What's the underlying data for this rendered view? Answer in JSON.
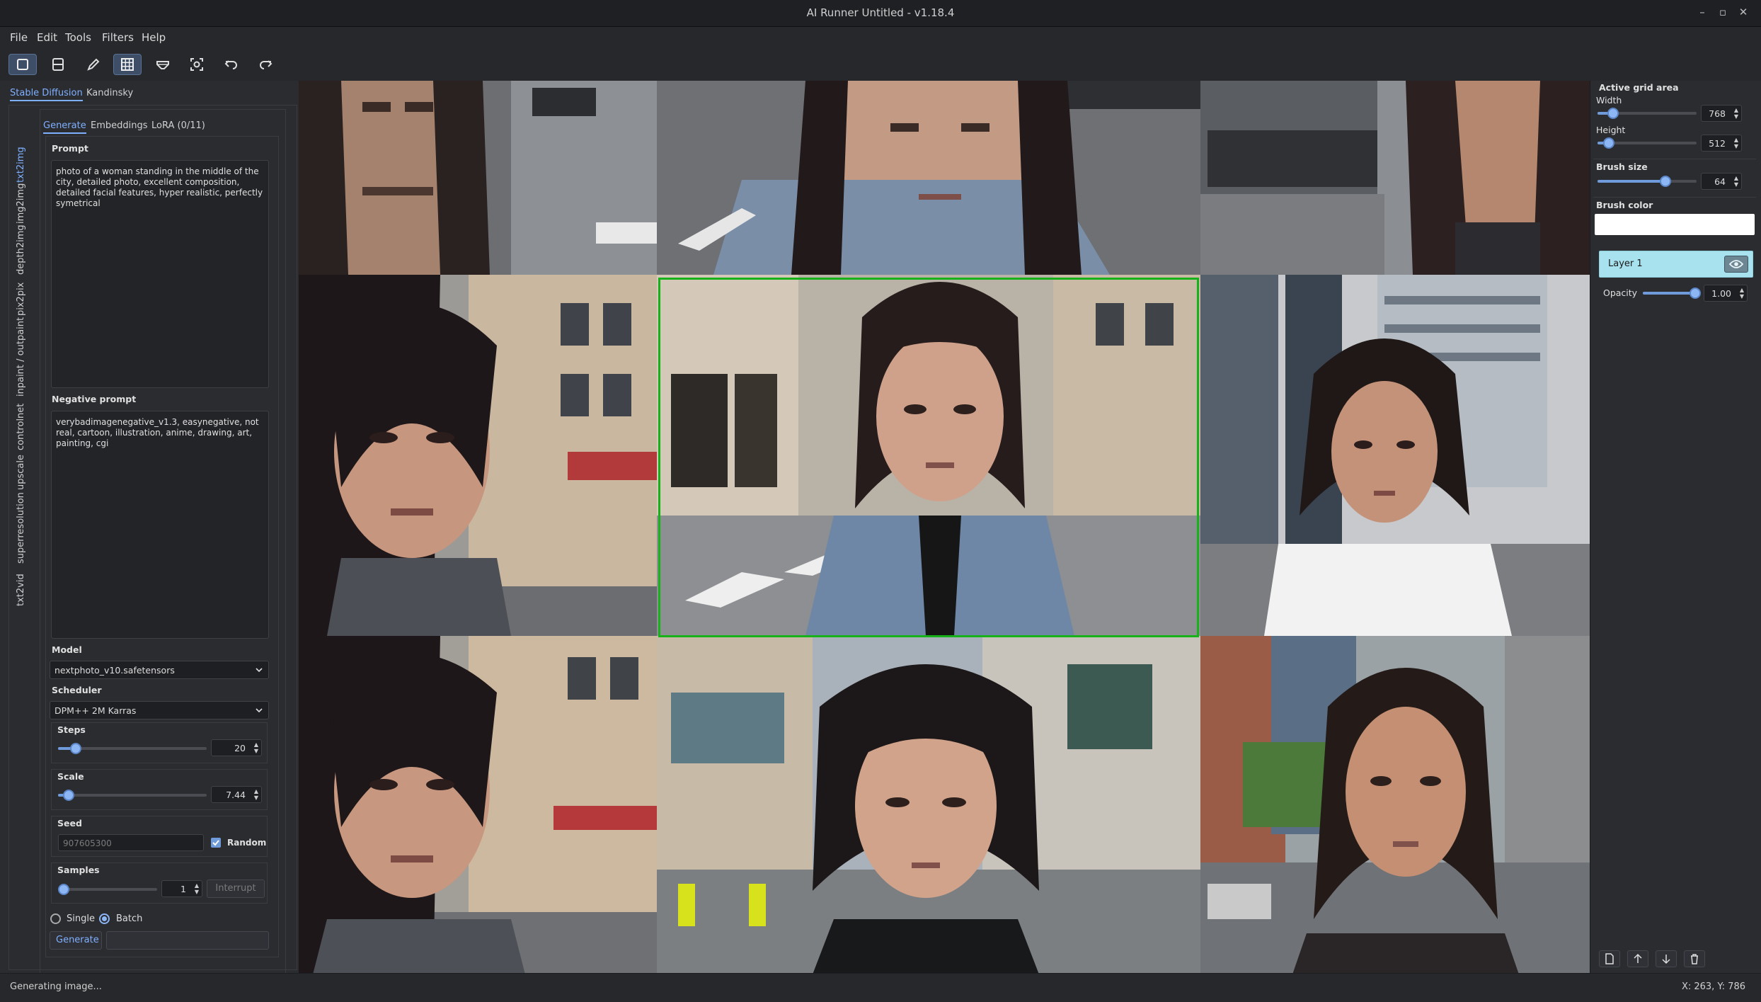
{
  "window": {
    "title": "AI Runner Untitled - v1.18.4",
    "minimize_glyph": "–",
    "maximize_glyph": "▫",
    "close_glyph": "✕"
  },
  "menu": [
    "File",
    "Edit",
    "Tools",
    "Filters",
    "Help"
  ],
  "toolbar": {
    "tools": [
      "active-grid-select-icon",
      "active-grid-half-icon",
      "brush-pencil-icon",
      "grid-icon",
      "eraser-icon",
      "focus-screenshot-icon",
      "undo-icon",
      "redo-icon"
    ]
  },
  "model_tabs": [
    "Stable Diffusion",
    "Kandinsky"
  ],
  "side_tabs": [
    "txt2img",
    "img2img",
    "depth2img",
    "pix2pix",
    "inpaint / outpaint",
    "controlnet",
    "upscale",
    "superresolution",
    "txt2vid"
  ],
  "sub_tabs": [
    "Generate",
    "Embeddings",
    "LoRA (0/11)"
  ],
  "prompt": {
    "label": "Prompt",
    "value": "photo of a woman standing in the middle of the city, detailed photo, excellent composition, detailed facial features, hyper realistic, perfectly symetrical"
  },
  "negative_prompt": {
    "label": "Negative prompt",
    "value": "verybadimagenegative_v1.3, easynegative, not real, cartoon, illustration, anime, drawing, art, painting, cgi"
  },
  "model": {
    "label": "Model",
    "value": "nextphoto_v10.safetensors"
  },
  "scheduler": {
    "label": "Scheduler",
    "value": "DPM++ 2M Karras"
  },
  "steps": {
    "label": "Steps",
    "value": "20",
    "level": 0.12
  },
  "scale": {
    "label": "Scale",
    "value": "7.44",
    "level": 0.07
  },
  "seed": {
    "label": "Seed",
    "value": "907605300",
    "random_label": "Random",
    "random_checked": true
  },
  "samples": {
    "label": "Samples",
    "value": "1",
    "interrupt_label": "Interrupt"
  },
  "mode": {
    "single_label": "Single",
    "batch_label": "Batch",
    "selected": "Batch"
  },
  "generate_label": "Generate",
  "right_panel": {
    "active_grid_title": "Active grid area",
    "width_label": "Width",
    "width_value": "768",
    "height_label": "Height",
    "height_value": "512",
    "brush_size_label": "Brush size",
    "brush_size_value": "64",
    "brush_color_label": "Brush color",
    "brush_color": "#ffffff",
    "layer_name": "Layer 1",
    "opacity_label": "Opacity",
    "opacity_value": "1.00",
    "bottom_icons": [
      "new-layer-icon",
      "move-up-icon",
      "move-down-icon",
      "delete-icon"
    ]
  },
  "status": {
    "message": "Generating image...",
    "coords": "X: 263, Y: 786"
  },
  "colors": {
    "accent": "#7fb0ff",
    "selection": "#17b11a",
    "layer_bg": "#a8e2ef"
  }
}
